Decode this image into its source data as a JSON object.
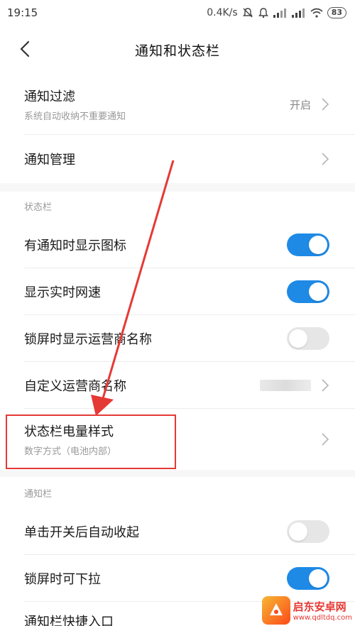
{
  "status_bar": {
    "time": "19:15",
    "net_speed": "0.4K/s",
    "battery": "83"
  },
  "title_bar": {
    "title": "通知和状态栏"
  },
  "notification_section": {
    "items": [
      {
        "label": "通知过滤",
        "sub": "系统自动收纳不重要通知",
        "value": "开启"
      },
      {
        "label": "通知管理"
      }
    ]
  },
  "status_bar_section": {
    "header": "状态栏",
    "items": [
      {
        "label": "有通知时显示图标",
        "toggle": "on"
      },
      {
        "label": "显示实时网速",
        "toggle": "on"
      },
      {
        "label": "锁屏时显示运营商名称",
        "toggle": "off"
      },
      {
        "label": "自定义运营商名称"
      },
      {
        "label": "状态栏电量样式",
        "sub": "数字方式（电池内部）"
      }
    ]
  },
  "notification_bar_section": {
    "header": "通知栏",
    "items": [
      {
        "label": "单击开关后自动收起",
        "toggle": "off"
      },
      {
        "label": "锁屏时可下拉",
        "toggle": "on"
      },
      {
        "label": "通知栏快捷入口"
      }
    ]
  },
  "watermark": {
    "name": "启东安卓网",
    "url": "www.qdltdq.com"
  },
  "colors": {
    "toggle_on": "#1e8ae6",
    "toggle_off": "#e6e6e6",
    "highlight": "#e53935"
  }
}
